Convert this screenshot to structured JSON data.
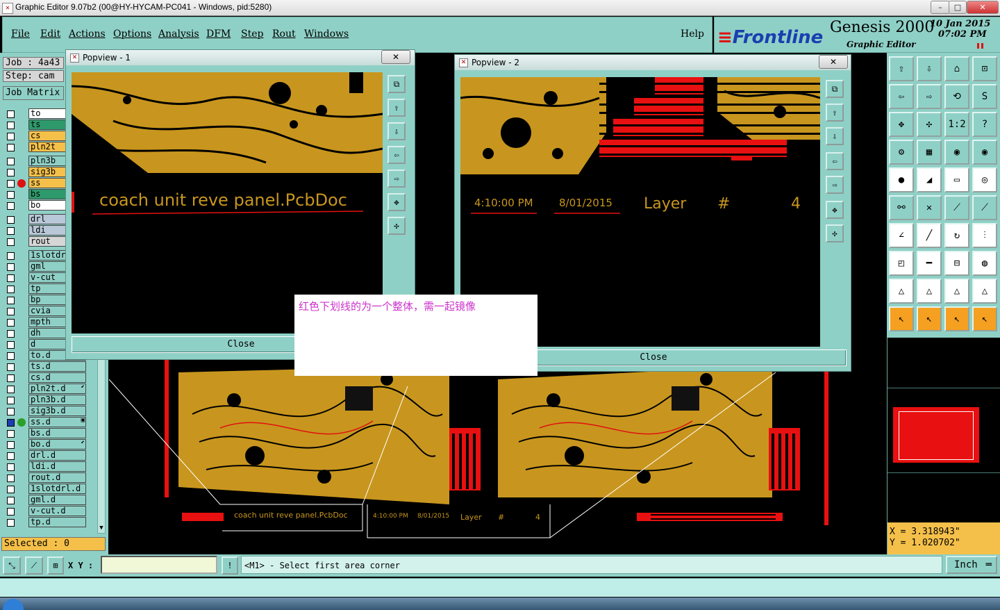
{
  "window": {
    "title": "Graphic Editor 9.07b2 (00@HY-HYCAM-PC041 - Windows, pid:5280)",
    "min": "–",
    "max": "□",
    "close": "✕"
  },
  "menu": {
    "items": [
      "File",
      "Edit",
      "Actions",
      "Options",
      "Analysis",
      "DFM",
      "Step",
      "Rout",
      "Windows"
    ],
    "help": "Help"
  },
  "brand": {
    "logo": "Frontline",
    "product": "Genesis 2000",
    "subtitle": "Graphic Editor",
    "date": "10 Jan 2015",
    "time": "07:02 PM"
  },
  "job": {
    "job_label": "Job : 4a43",
    "step_label": "Step: cam",
    "matrix_btn": "Job Matrix"
  },
  "layers": [
    {
      "name": "to",
      "color": "#ffffff",
      "dot": ""
    },
    {
      "name": "ts",
      "color": "#2e9a6b",
      "dot": ""
    },
    {
      "name": "cs",
      "color": "#f5c04a",
      "dot": ""
    },
    {
      "name": "pln2t",
      "color": "#f5c04a",
      "dot": ""
    },
    {
      "name": "pln3b",
      "color": "#8fd0c6",
      "dot": ""
    },
    {
      "name": "sig3b",
      "color": "#f5c04a",
      "dot": ""
    },
    {
      "name": "ss",
      "color": "#f5c04a",
      "dot": "#e01010"
    },
    {
      "name": "bs",
      "color": "#2e9a6b",
      "dot": ""
    },
    {
      "name": "bo",
      "color": "#ffffff",
      "dot": ""
    },
    {
      "name": "drl",
      "color": "#b8c8d8",
      "dot": ""
    },
    {
      "name": "ldi",
      "color": "#b8c8d8",
      "dot": ""
    },
    {
      "name": "rout",
      "color": "#d6d6d6",
      "dot": ""
    },
    {
      "name": "1slotdr",
      "color": "#8fd0c6",
      "dot": ""
    },
    {
      "name": "gml",
      "color": "#8fd0c6",
      "dot": ""
    },
    {
      "name": "v-cut",
      "color": "#8fd0c6",
      "dot": ""
    },
    {
      "name": "tp",
      "color": "#8fd0c6",
      "dot": ""
    },
    {
      "name": "bp",
      "color": "#8fd0c6",
      "dot": ""
    },
    {
      "name": "cvia",
      "color": "#8fd0c6",
      "dot": ""
    },
    {
      "name": "mpth",
      "color": "#8fd0c6",
      "dot": ""
    },
    {
      "name": "dh",
      "color": "#8fd0c6",
      "dot": ""
    },
    {
      "name": "d",
      "color": "#8fd0c6",
      "dot": ""
    },
    {
      "name": "to.d",
      "color": "#8fd0c6",
      "dot": "",
      "mark": "⬋"
    },
    {
      "name": "ts.d",
      "color": "#8fd0c6",
      "dot": ""
    },
    {
      "name": "cs.d",
      "color": "#8fd0c6",
      "dot": ""
    },
    {
      "name": "pln2t.d",
      "color": "#8fd0c6",
      "dot": "",
      "mark": "⬋"
    },
    {
      "name": "pln3b.d",
      "color": "#8fd0c6",
      "dot": ""
    },
    {
      "name": "sig3b.d",
      "color": "#8fd0c6",
      "dot": ""
    },
    {
      "name": "ss.d",
      "color": "#8fd0c6",
      "dot": "#2aa02a",
      "mark": "▣"
    },
    {
      "name": "bs.d",
      "color": "#8fd0c6",
      "dot": ""
    },
    {
      "name": "bo.d",
      "color": "#8fd0c6",
      "dot": "",
      "mark": "⬋"
    },
    {
      "name": "drl.d",
      "color": "#8fd0c6",
      "dot": ""
    },
    {
      "name": "ldi.d",
      "color": "#8fd0c6",
      "dot": ""
    },
    {
      "name": "rout.d",
      "color": "#8fd0c6",
      "dot": ""
    },
    {
      "name": "1slotdrl.d",
      "color": "#8fd0c6",
      "dot": ""
    },
    {
      "name": "gml.d",
      "color": "#8fd0c6",
      "dot": ""
    },
    {
      "name": "v-cut.d",
      "color": "#8fd0c6",
      "dot": ""
    },
    {
      "name": "tp.d",
      "color": "#8fd0c6",
      "dot": ""
    }
  ],
  "selected": "Selected : 0",
  "popview1": {
    "title": "Popview - 1",
    "board_text": "coach unit reve panel.PcbDoc",
    "close": "Close"
  },
  "popview2": {
    "title": "Popview - 2",
    "time": "4:10:00 PM",
    "date": "8/01/2015",
    "layer_label": "Layer",
    "hash": "#",
    "layer_num": "4",
    "close": "Close"
  },
  "note": "红色下划线的为一个整体，需一起镜像",
  "main_canvas": {
    "label1": "coach unit reve panel.PcbDoc",
    "label2_time": "4:10:00 PM",
    "label2_date": "8/01/2015",
    "label2_layer": "Layer",
    "label2_hash": "#",
    "label2_num": "4"
  },
  "coords": {
    "x": "X = 3.318943\"",
    "y": "Y = 1.020702\""
  },
  "cmd": {
    "xy_label": "X Y :",
    "xy_value": "",
    "prompt": "<M1> - Select first area corner",
    "units": "Inch"
  },
  "colors": {
    "teal": "#8fd0c6",
    "copper": "#c8961e",
    "red": "#e81010",
    "magenta": "#cc33cc"
  }
}
